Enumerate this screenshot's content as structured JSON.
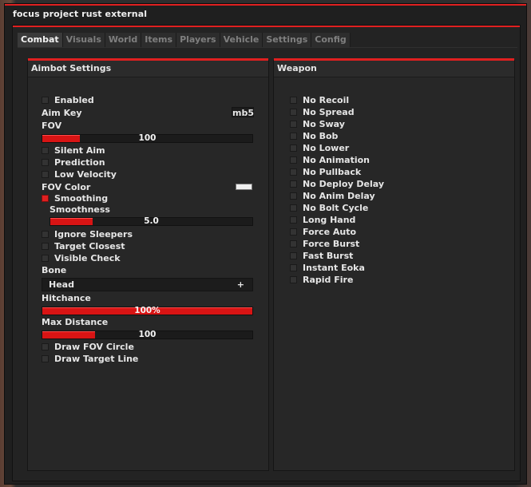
{
  "window": {
    "title": "focus project rust external"
  },
  "tabs": [
    "Combat",
    "Visuals",
    "World",
    "Items",
    "Players",
    "Vehicle",
    "Settings",
    "Config"
  ],
  "aimbot": {
    "header": "Aimbot Settings",
    "enabled": "Enabled",
    "aim_key_label": "Aim Key",
    "aim_key_value": "mb5",
    "fov_label": "FOV",
    "fov_value": "100",
    "fov_fraction": 0.18,
    "silent_aim": "Silent Aim",
    "prediction": "Prediction",
    "low_velocity": "Low Velocity",
    "fov_color_label": "FOV Color",
    "fov_color": "#efefef",
    "smoothing": "Smoothing",
    "smoothness_label": "Smoothness",
    "smoothness_value": "5.0",
    "smoothness_fraction": 0.21,
    "ignore_sleepers": "Ignore Sleepers",
    "target_closest": "Target Closest",
    "visible_check": "Visible Check",
    "bone_label": "Bone",
    "bone_value": "Head",
    "bone_expand": "+",
    "hitchance_label": "Hitchance",
    "hitchance_value": "100%",
    "hitchance_fraction": 1.0,
    "max_distance_label": "Max Distance",
    "max_distance_value": "100",
    "max_distance_fraction": 0.25,
    "draw_fov_circle": "Draw FOV Circle",
    "draw_target_line": "Draw Target Line"
  },
  "weapon": {
    "header": "Weapon",
    "items": [
      "No Recoil",
      "No Spread",
      "No Sway",
      "No Bob",
      "No Lower",
      "No Animation",
      "No Pullback",
      "No Deploy Delay",
      "No Anim Delay",
      "No Bolt Cycle",
      "Long Hand",
      "Force Auto",
      "Force Burst",
      "Fast Burst",
      "Instant Eoka",
      "Rapid Fire"
    ]
  },
  "colors": {
    "accent": "#e02020",
    "panel": "#272727",
    "checked": "#e02020"
  }
}
